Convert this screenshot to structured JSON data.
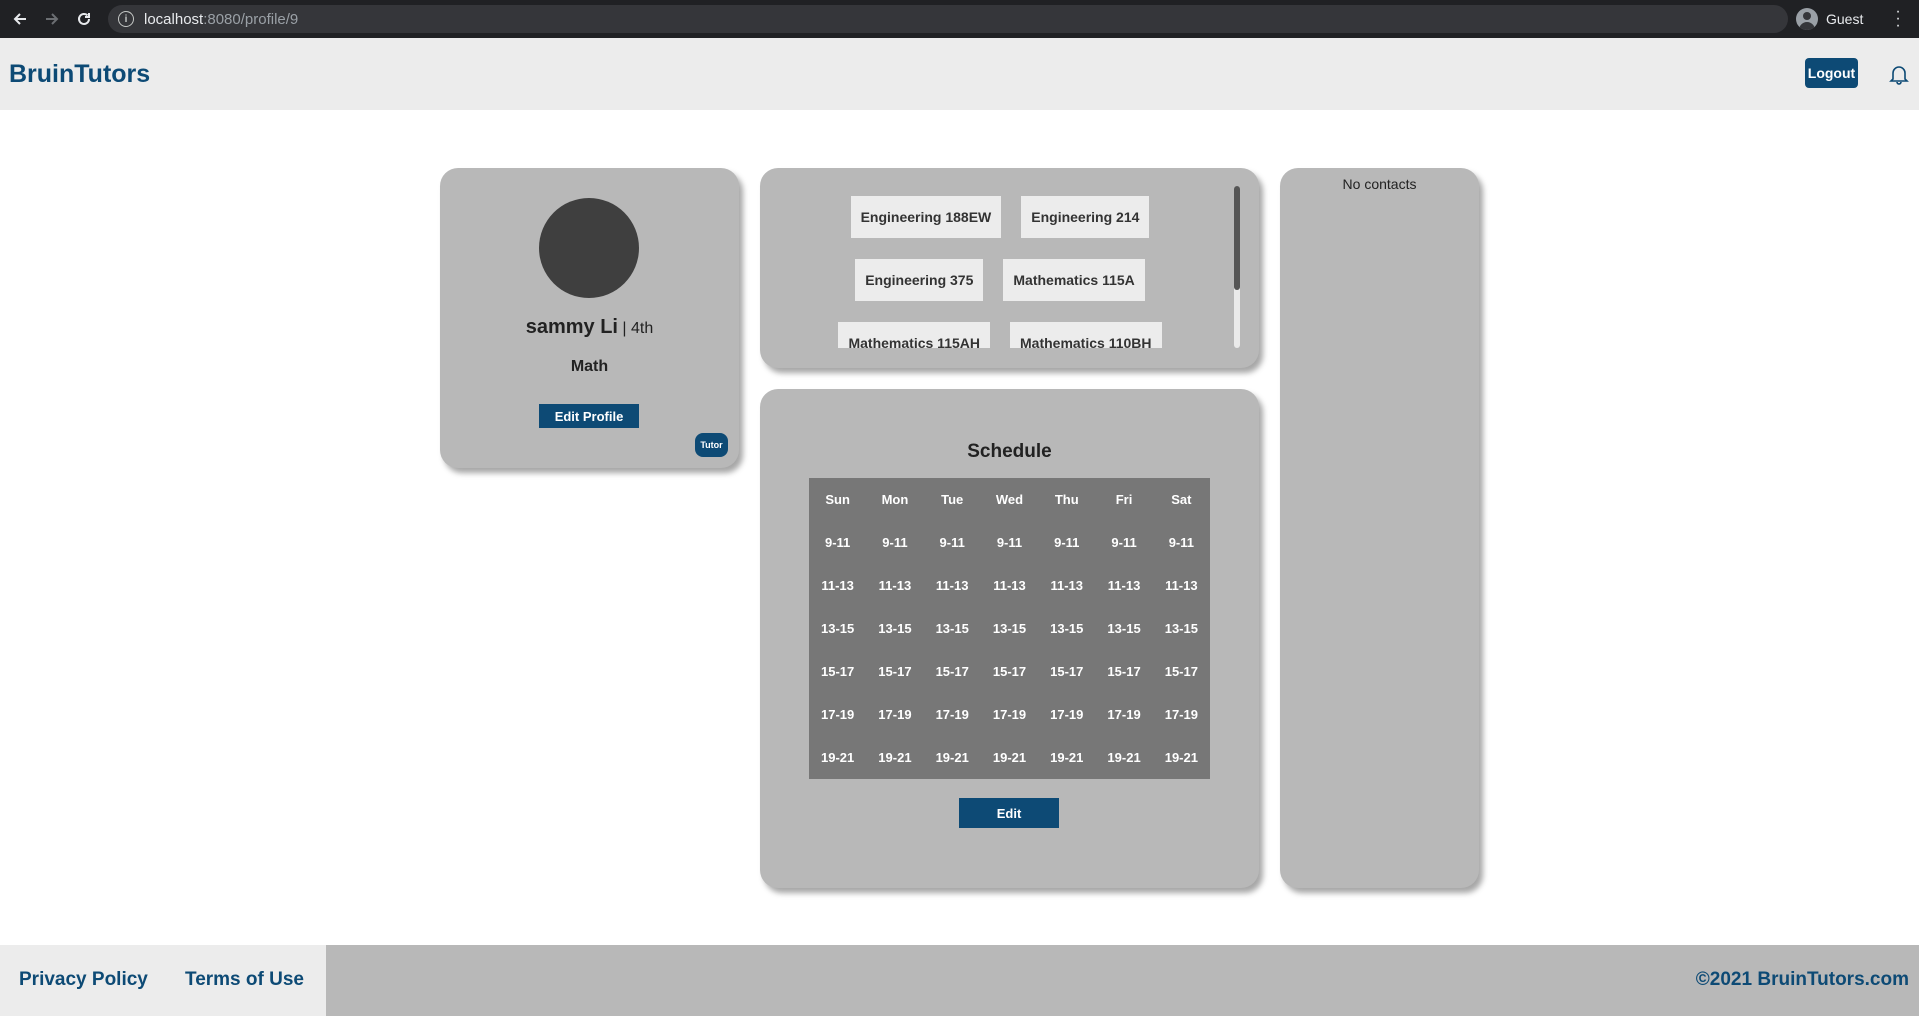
{
  "browser": {
    "url_host": "localhost",
    "url_rest": ":8080/profile/9",
    "profile_name": "Guest"
  },
  "header": {
    "brand": "BruinTutors",
    "logout_label": "Logout"
  },
  "profile": {
    "name": "sammy Li",
    "separator": " | ",
    "year": "4th",
    "major": "Math",
    "edit_label": "Edit Profile",
    "role_badge": "Tutor"
  },
  "courses": [
    [
      "Engineering 188EW",
      "Engineering 214"
    ],
    [
      "Engineering 375",
      "Mathematics 115A"
    ],
    [
      "Mathematics 115AH",
      "Mathematics 110BH"
    ]
  ],
  "schedule": {
    "title": "Schedule",
    "days": [
      "Sun",
      "Mon",
      "Tue",
      "Wed",
      "Thu",
      "Fri",
      "Sat"
    ],
    "slots": [
      "9-11",
      "11-13",
      "13-15",
      "15-17",
      "17-19",
      "19-21"
    ],
    "edit_label": "Edit"
  },
  "contacts": {
    "empty_text": "No contacts"
  },
  "footer": {
    "privacy": "Privacy Policy",
    "terms": "Terms of Use",
    "copyright": "©2021 BruinTutors.com"
  },
  "colors": {
    "brand": "#0d4a75",
    "card": "#b8b8b8",
    "table": "#777777",
    "header_bg": "#ececec"
  }
}
